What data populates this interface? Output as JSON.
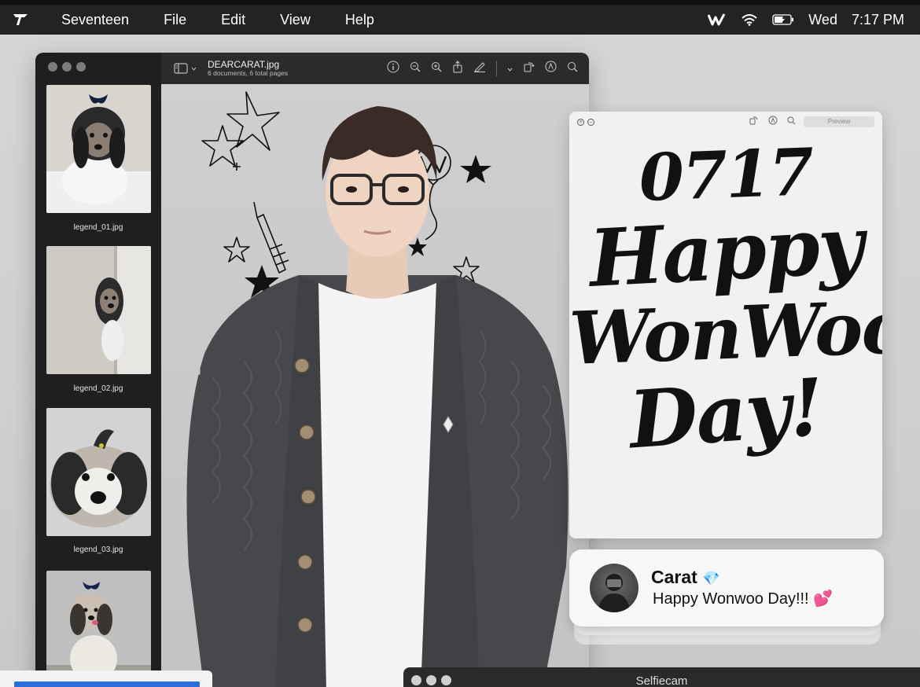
{
  "menubar": {
    "app_name": "Seventeen",
    "items": [
      "File",
      "Edit",
      "View",
      "Help"
    ],
    "day": "Wed",
    "time": "7:17 PM"
  },
  "preview": {
    "doc_name": "DEARCARAT.jpg",
    "doc_sub": "6 documents, 6 total pages",
    "thumbnails": [
      {
        "label": "legend_01.jpg"
      },
      {
        "label": "legend_02.jpg"
      },
      {
        "label": "legend_03.jpg"
      }
    ]
  },
  "poster": {
    "preview_button": "Preview",
    "line1": "0717",
    "line2": "Happy",
    "line3": "WonWoo",
    "line4": "Day!"
  },
  "notification": {
    "title": "Carat",
    "title_emoji": "💎",
    "body": "Happy Wonwoo Day!!!",
    "body_emoji": "💕"
  },
  "selfiecam": {
    "title": "Selfiecam"
  },
  "colors": {
    "menubar": "#232323",
    "sidebar": "#1f1f1f",
    "toolbar": "#2b2b2b",
    "accent_blue": "#2a6fdb"
  }
}
